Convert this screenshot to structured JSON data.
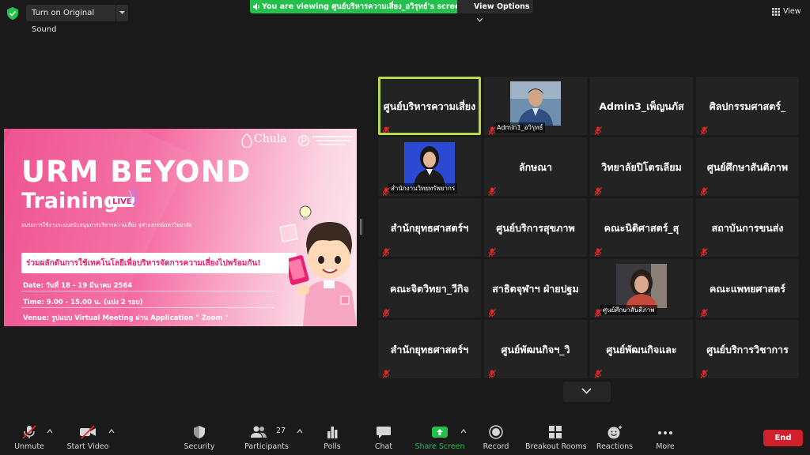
{
  "topbar": {
    "sound_button": "Turn on Original Sound",
    "viewing_banner": "You are viewing ศูนย์บริหารความเสี่ยง_อวิรุทธ์'s screen",
    "view_options": "View Options",
    "view_button": "View"
  },
  "shared_screen": {
    "brand": "Chula",
    "title_line1": "URM BEYOND",
    "title_line2": "Training",
    "live_badge": "LIVE",
    "subtitle": "อบรมการใช้งานระบบสนับสนุนการบริหารความเสี่ยง จุฬาลงกรณ์มหาวิทยาลัย",
    "slogan": "ร่วมผลักดันการใช้เทคโนโลยีเพื่อบริหารจัดการความเสี่ยงไปพร้อมกัน!",
    "date_line": "Date: วันที่ 18 - 19 มีนาคม 2564",
    "time_line": "Time: 9.00 - 15.00 น. (แบ่ง 2 รอบ)",
    "venue_line": "Venue: รูปแบบ Virtual Meeting ผ่าน Application \" Zoom \""
  },
  "participants": [
    {
      "name": "ศูนย์บริหารความเสี่ยง",
      "active": true
    },
    {
      "name": "",
      "label": "Admin1_อวิรุทธ์",
      "video": "man"
    },
    {
      "name": "Admin3_เพ็ญนภัส"
    },
    {
      "name": "ศิลปกรรมศาสตร์_"
    },
    {
      "name": "",
      "label": "สำนักงานวิทยทรัพยากร",
      "video": "woman"
    },
    {
      "name": "ลักษณา"
    },
    {
      "name": "วิทยาลัยปิโตรเลียม"
    },
    {
      "name": "ศูนย์ศึกษาสันติภาพ"
    },
    {
      "name": "สำนักยุทธศาสตร์ฯ"
    },
    {
      "name": "ศูนย์บริการสุขภาพ"
    },
    {
      "name": "คณะนิติศาสตร์_สุ"
    },
    {
      "name": "สถาบันการขนส่ง"
    },
    {
      "name": "คณะจิตวิทยา_วีกิจ"
    },
    {
      "name": "สาธิตจุฬาฯ ฝ่ายปฐม"
    },
    {
      "name": "",
      "label": "ศูนย์ศึกษาสันติภาพ",
      "video": "woman2"
    },
    {
      "name": "คณะแพทยศาสตร์"
    },
    {
      "name": "สำนักยุทธศาสตร์ฯ"
    },
    {
      "name": "ศูนย์พัฒนกิจฯ_วิ"
    },
    {
      "name": "ศูนย์พัฒนกิจและ"
    },
    {
      "name": "ศูนย์บริการวิชาการ"
    }
  ],
  "toolbar": {
    "unmute": "Unmute",
    "start_video": "Start Video",
    "security": "Security",
    "participants": "Participants",
    "participants_count": "27",
    "polls": "Polls",
    "chat": "Chat",
    "share_screen": "Share Screen",
    "record": "Record",
    "breakout_rooms": "Breakout Rooms",
    "reactions": "Reactions",
    "more": "More",
    "end": "End"
  },
  "colors": {
    "banner_green": "#23c04c",
    "active_border": "#b9d84a",
    "end_red": "#d0202b",
    "share_green": "#23c04c",
    "mic_off_red": "#e02828"
  }
}
